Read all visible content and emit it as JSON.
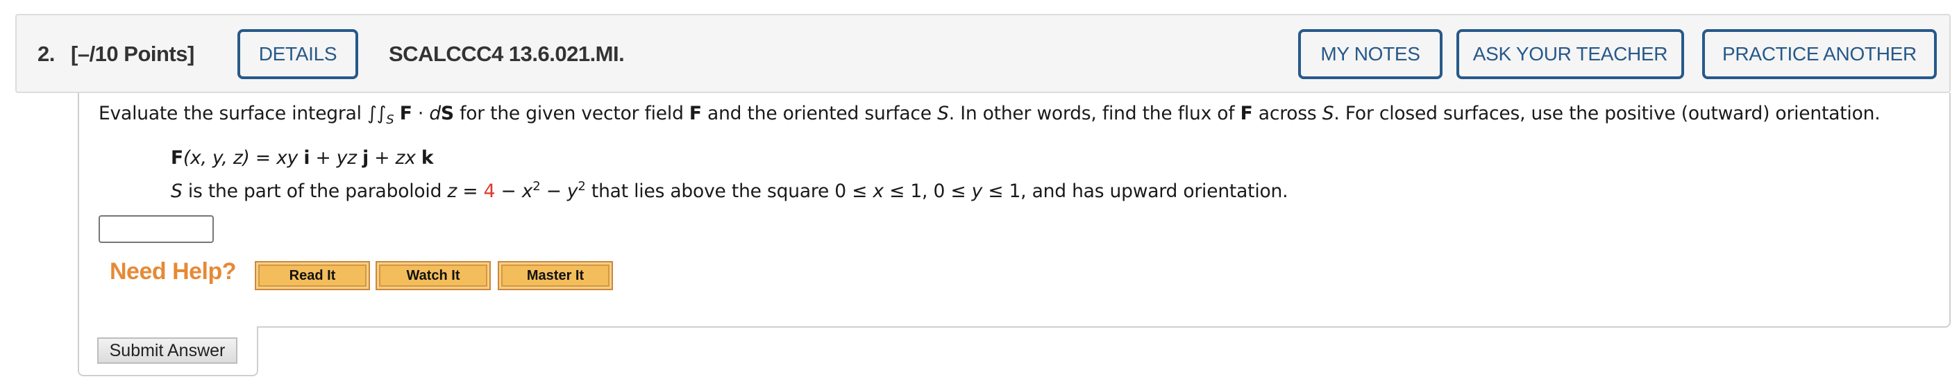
{
  "header": {
    "question_number": "2.",
    "points": "[–/10 Points]",
    "details_label": "DETAILS",
    "question_code": "SCALCCC4 13.6.021.MI.",
    "my_notes_label": "MY NOTES",
    "ask_teacher_label": "ASK YOUR TEACHER",
    "practice_another_label": "PRACTICE ANOTHER"
  },
  "prompt": {
    "part1": "Evaluate the surface integral ",
    "integral": "∫∫",
    "integral_sub": "S",
    "F": "F",
    "dot": " · ",
    "d": "d",
    "S_bold": "S",
    "part2": " for the given vector field ",
    "F2": "F",
    "part3": " and the oriented surface ",
    "S_ital": "S",
    "part4": ". In other words, find the flux of ",
    "F3": "F",
    "part5": " across ",
    "S_ital2": "S",
    "part6": ". For closed surfaces, use the positive (outward) orientation."
  },
  "field": {
    "F": "F",
    "args": "(x, y, z)",
    "eq": " = ",
    "t1": "xy",
    "i": "i",
    "plus1": " + ",
    "t2": "yz",
    "j": "j",
    "plus2": " + ",
    "t3": "zx",
    "k": "k"
  },
  "surface": {
    "S": "S",
    "text1": " is the part of the paraboloid ",
    "z": "z",
    "eq": " = ",
    "const": "4",
    "minus1": " − ",
    "x": "x",
    "exp1": "2",
    "minus2": " − ",
    "y": "y",
    "exp2": "2",
    "text2": " that lies above the square 0 ≤ ",
    "x2": "x",
    "text3": " ≤ 1, 0 ≤ ",
    "y2": "y",
    "text4": " ≤ 1, and has upward orientation."
  },
  "answer": {
    "value": ""
  },
  "help": {
    "label": "Need Help?",
    "buttons": [
      "Read It",
      "Watch It",
      "Master It"
    ]
  },
  "submit_label": "Submit Answer"
}
